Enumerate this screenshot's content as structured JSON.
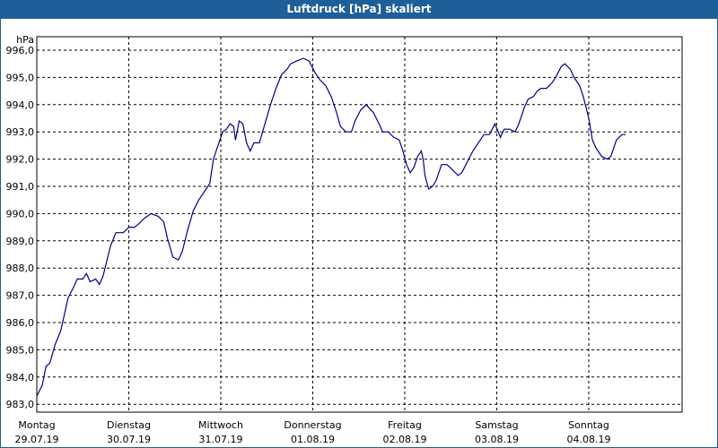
{
  "title": "Luftdruck [hPa] skaliert",
  "chart_data": {
    "type": "line",
    "title": "Luftdruck [hPa] skaliert",
    "ylabel": "hPa",
    "xlabel": "",
    "ylim": [
      983.0,
      996.0
    ],
    "grid": true,
    "yticks": [
      "996,0",
      "995,0",
      "994,0",
      "993,0",
      "992,0",
      "991,0",
      "990,0",
      "989,0",
      "988,0",
      "987,0",
      "986,0",
      "985,0",
      "984,0",
      "983,0"
    ],
    "x_day_ticks": [
      {
        "day": "Montag",
        "date": "29.07.19"
      },
      {
        "day": "Dienstag",
        "date": "30.07.19"
      },
      {
        "day": "Mittwoch",
        "date": "31.07.19"
      },
      {
        "day": "Donnerstag",
        "date": "01.08.19"
      },
      {
        "day": "Freitag",
        "date": "02.08.19"
      },
      {
        "day": "Samstag",
        "date": "03.08.19"
      },
      {
        "day": "Sonntag",
        "date": "04.08.19"
      }
    ],
    "series": [
      {
        "color": "#00008b",
        "points": [
          [
            0.0,
            983.3
          ],
          [
            0.06,
            983.7
          ],
          [
            0.1,
            984.4
          ],
          [
            0.14,
            984.5
          ],
          [
            0.2,
            985.2
          ],
          [
            0.26,
            985.7
          ],
          [
            0.3,
            986.3
          ],
          [
            0.34,
            986.9
          ],
          [
            0.4,
            987.3
          ],
          [
            0.44,
            987.6
          ],
          [
            0.5,
            987.6
          ],
          [
            0.54,
            987.8
          ],
          [
            0.58,
            987.5
          ],
          [
            0.64,
            987.6
          ],
          [
            0.68,
            987.4
          ],
          [
            0.72,
            987.7
          ],
          [
            0.8,
            988.8
          ],
          [
            0.86,
            989.3
          ],
          [
            0.94,
            989.3
          ],
          [
            1.0,
            989.5
          ],
          [
            1.06,
            989.5
          ],
          [
            1.1,
            989.6
          ],
          [
            1.16,
            989.8
          ],
          [
            1.24,
            990.0
          ],
          [
            1.32,
            989.9
          ],
          [
            1.38,
            989.7
          ],
          [
            1.42,
            989.1
          ],
          [
            1.48,
            988.4
          ],
          [
            1.54,
            988.3
          ],
          [
            1.58,
            988.6
          ],
          [
            1.64,
            989.4
          ],
          [
            1.7,
            990.1
          ],
          [
            1.76,
            990.5
          ],
          [
            1.8,
            990.7
          ],
          [
            1.84,
            990.9
          ],
          [
            1.88,
            991.1
          ],
          [
            1.92,
            992.0
          ],
          [
            1.98,
            992.6
          ],
          [
            2.02,
            993.0
          ],
          [
            2.06,
            993.1
          ],
          [
            2.1,
            993.3
          ],
          [
            2.14,
            993.2
          ],
          [
            2.16,
            992.7
          ],
          [
            2.2,
            993.4
          ],
          [
            2.24,
            993.3
          ],
          [
            2.28,
            992.6
          ],
          [
            2.32,
            992.3
          ],
          [
            2.36,
            992.6
          ],
          [
            2.42,
            992.6
          ],
          [
            2.48,
            993.3
          ],
          [
            2.54,
            994.0
          ],
          [
            2.6,
            994.6
          ],
          [
            2.66,
            995.1
          ],
          [
            2.72,
            995.3
          ],
          [
            2.76,
            995.5
          ],
          [
            2.82,
            995.6
          ],
          [
            2.9,
            995.7
          ],
          [
            2.96,
            995.6
          ],
          [
            3.02,
            995.2
          ],
          [
            3.08,
            994.9
          ],
          [
            3.14,
            994.7
          ],
          [
            3.2,
            994.3
          ],
          [
            3.26,
            993.7
          ],
          [
            3.3,
            993.2
          ],
          [
            3.36,
            993.0
          ],
          [
            3.42,
            993.0
          ],
          [
            3.46,
            993.4
          ],
          [
            3.52,
            993.8
          ],
          [
            3.58,
            994.0
          ],
          [
            3.66,
            993.7
          ],
          [
            3.72,
            993.3
          ],
          [
            3.76,
            993.0
          ],
          [
            3.82,
            993.0
          ],
          [
            3.88,
            992.8
          ],
          [
            3.94,
            992.7
          ],
          [
            3.98,
            992.3
          ],
          [
            4.02,
            991.8
          ],
          [
            4.06,
            991.5
          ],
          [
            4.1,
            991.7
          ],
          [
            4.14,
            992.1
          ],
          [
            4.18,
            992.3
          ],
          [
            4.2,
            992.0
          ],
          [
            4.22,
            991.4
          ],
          [
            4.26,
            990.9
          ],
          [
            4.3,
            991.0
          ],
          [
            4.34,
            991.2
          ],
          [
            4.4,
            991.8
          ],
          [
            4.46,
            991.8
          ],
          [
            4.52,
            991.6
          ],
          [
            4.58,
            991.4
          ],
          [
            4.62,
            991.5
          ],
          [
            4.68,
            991.9
          ],
          [
            4.74,
            992.3
          ],
          [
            4.8,
            992.6
          ],
          [
            4.86,
            992.9
          ],
          [
            4.92,
            992.9
          ],
          [
            4.98,
            993.3
          ],
          [
            5.04,
            992.8
          ],
          [
            5.08,
            993.1
          ],
          [
            5.14,
            993.1
          ],
          [
            5.2,
            993.0
          ],
          [
            5.24,
            993.3
          ],
          [
            5.3,
            993.9
          ],
          [
            5.34,
            994.2
          ],
          [
            5.4,
            994.3
          ],
          [
            5.44,
            994.5
          ],
          [
            5.48,
            994.6
          ],
          [
            5.54,
            994.6
          ],
          [
            5.6,
            994.8
          ],
          [
            5.64,
            995.0
          ],
          [
            5.7,
            995.4
          ],
          [
            5.74,
            995.5
          ],
          [
            5.8,
            995.3
          ],
          [
            5.84,
            995.0
          ],
          [
            5.9,
            994.7
          ],
          [
            5.94,
            994.3
          ],
          [
            6.0,
            993.5
          ],
          [
            6.04,
            992.7
          ],
          [
            6.08,
            992.4
          ],
          [
            6.14,
            992.1
          ],
          [
            6.2,
            992.0
          ],
          [
            6.24,
            992.1
          ],
          [
            6.3,
            992.7
          ],
          [
            6.36,
            992.9
          ],
          [
            6.4,
            992.9
          ]
        ]
      }
    ]
  }
}
